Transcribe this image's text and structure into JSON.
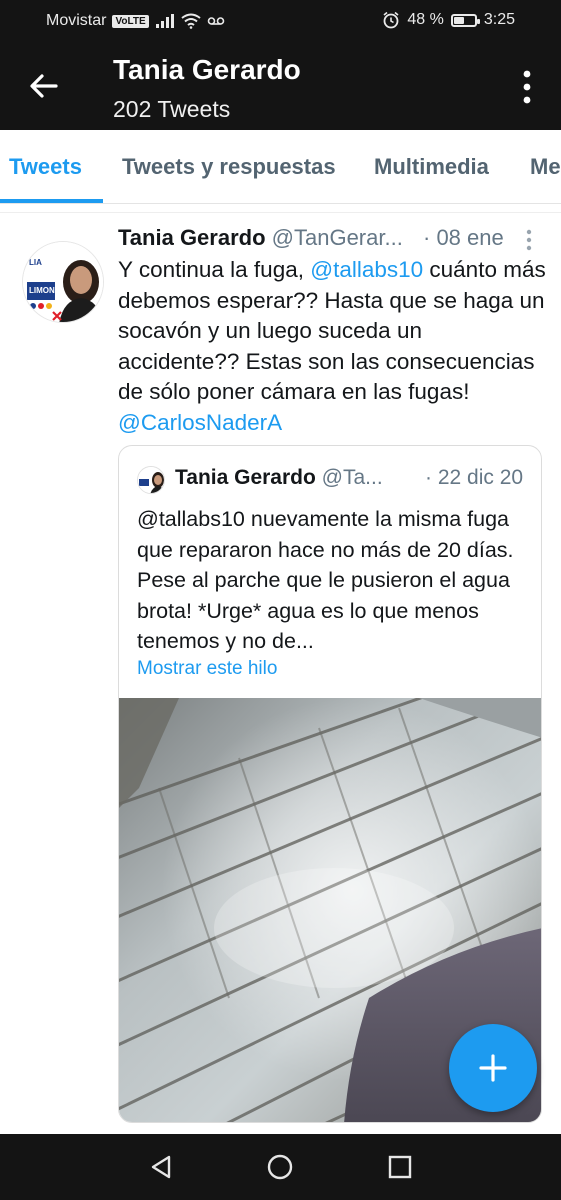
{
  "status_bar": {
    "carrier": "Movistar",
    "volte": "VoLTE",
    "battery_text": "48 %",
    "battery_level": 0.48,
    "time": "3:25"
  },
  "header": {
    "title": "Tania Gerardo",
    "subtitle": "202 Tweets",
    "icons": [
      "back-arrow-icon",
      "more-vertical-icon"
    ]
  },
  "tabs": [
    {
      "label": "Tweets",
      "active": true
    },
    {
      "label": "Tweets y respuestas",
      "active": false
    },
    {
      "label": "Multimedia",
      "active": false
    },
    {
      "label": "Me",
      "active": false
    }
  ],
  "tweet": {
    "author_name": "Tania Gerardo",
    "author_handle": "@TanGerar...",
    "date": "· 08 ene",
    "text_1": "Y continua la fuga, ",
    "mention_1": "@tallabs10",
    "text_2": " cuánto más debemos esperar?? Hasta que se haga un socavón y un luego suceda un accidente?? Estas son las consecuencias de sólo poner cámara en las fugas! ",
    "mention_2": "@CarlosNaderA",
    "avatar_text": {
      "line1": "LIA",
      "line2": "LIMON"
    },
    "quoted": {
      "author_name": "Tania Gerardo",
      "author_handle": "@Ta...",
      "date": "· 22 dic 20",
      "text": "@tallabs10 nuevamente la misma fuga que repararon hace no más de 20 días. Pese al parche que le pusieron el agua brota! *Urge* agua es lo que menos tenemos y no de...",
      "show_thread": "Mostrar este hilo"
    }
  },
  "fab": {
    "icon": "plus-icon"
  },
  "colors": {
    "accent": "#1d9bf0",
    "bar_background": "#141414",
    "secondary_text": "#657786"
  }
}
